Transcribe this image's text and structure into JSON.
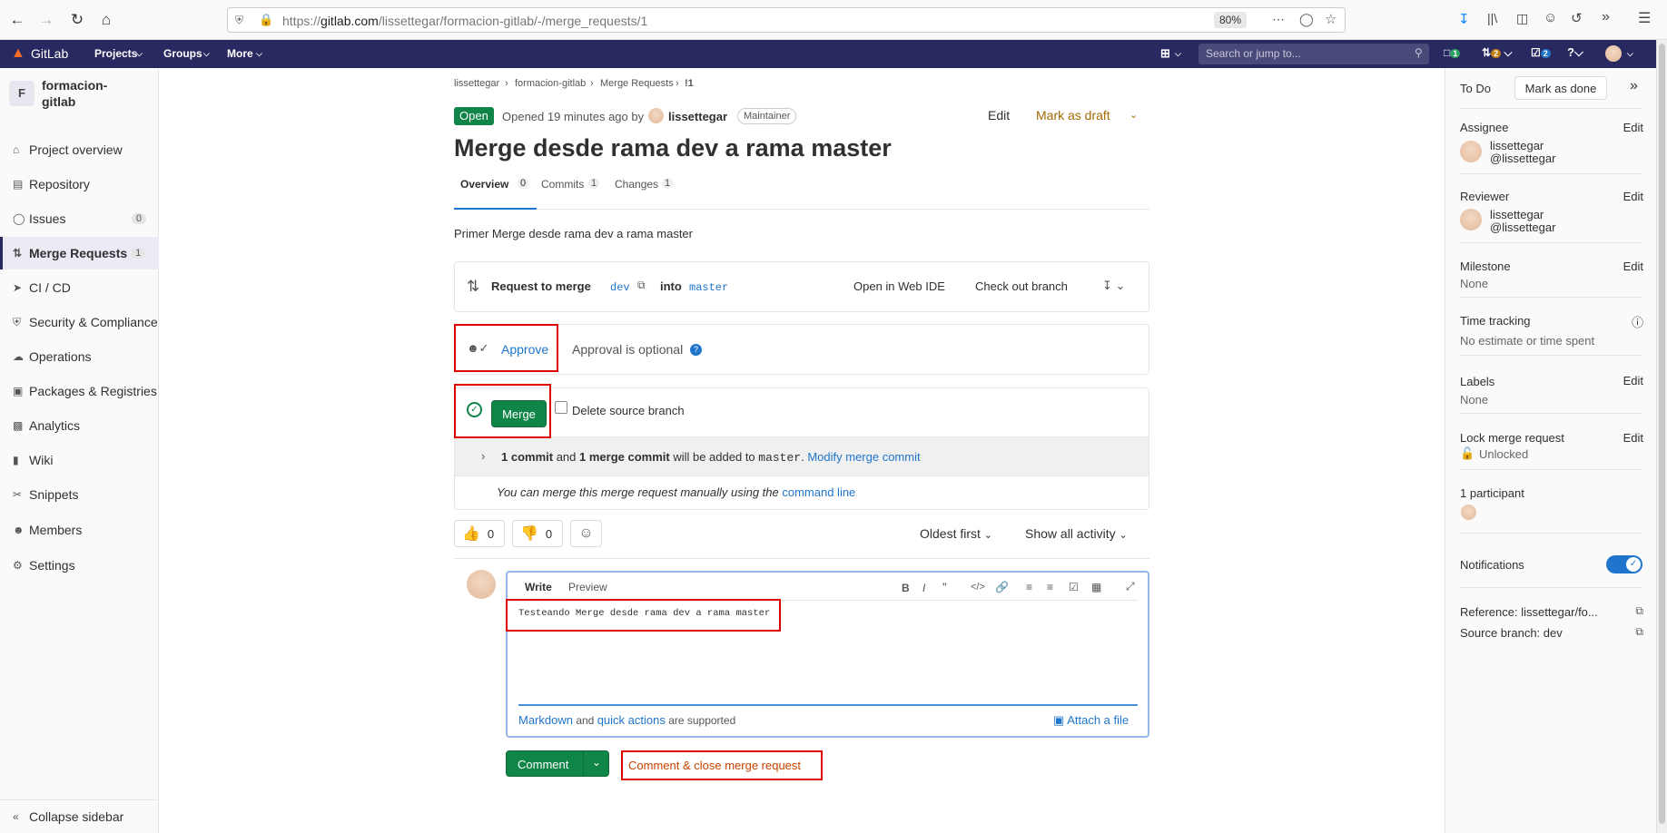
{
  "browser": {
    "url_prefix": "https://",
    "url_domain": "gitlab.com",
    "url_path": "/lissettegar/formacion-gitlab/-/merge_requests/1",
    "zoom": "80%"
  },
  "topbar": {
    "brand": "GitLab",
    "menus": [
      "Projects",
      "Groups",
      "More"
    ],
    "search_placeholder": "Search or jump to...",
    "counters": {
      "issues": "1",
      "merge_requests": "2",
      "todos": "2"
    }
  },
  "sidebar": {
    "project_initial": "F",
    "project_name_line1": "formacion-",
    "project_name_line2": "gitlab",
    "items": [
      {
        "label": "Project overview",
        "icon": "home-icon"
      },
      {
        "label": "Repository",
        "icon": "doc-icon"
      },
      {
        "label": "Issues",
        "icon": "issues-icon",
        "badge": "0"
      },
      {
        "label": "Merge Requests",
        "icon": "merge-request-icon",
        "badge": "1"
      },
      {
        "label": "CI / CD",
        "icon": "rocket-icon"
      },
      {
        "label": "Security & Compliance",
        "icon": "shield-icon"
      },
      {
        "label": "Operations",
        "icon": "cloud-icon"
      },
      {
        "label": "Packages & Registries",
        "icon": "package-icon"
      },
      {
        "label": "Analytics",
        "icon": "chart-icon"
      },
      {
        "label": "Wiki",
        "icon": "book-icon"
      },
      {
        "label": "Snippets",
        "icon": "scissors-icon"
      },
      {
        "label": "Members",
        "icon": "users-icon"
      },
      {
        "label": "Settings",
        "icon": "gear-icon"
      }
    ],
    "collapse": "Collapse sidebar"
  },
  "breadcrumb": [
    "lissettegar",
    "formacion-gitlab",
    "Merge Requests",
    "!1"
  ],
  "mr": {
    "status": "Open",
    "opened_text": "Opened 19 minutes ago by",
    "author": "lissettegar",
    "role": "Maintainer",
    "edit": "Edit",
    "mark_draft": "Mark as draft",
    "title": "Merge desde rama dev a rama master",
    "tabs": [
      {
        "label": "Overview",
        "count": "0"
      },
      {
        "label": "Commits",
        "count": "1"
      },
      {
        "label": "Changes",
        "count": "1"
      }
    ],
    "description": "Primer Merge desde rama dev a rama master",
    "request_to_merge": "Request to merge",
    "source_branch": "dev",
    "into": "into",
    "target_branch": "master",
    "open_web_ide": "Open in Web IDE",
    "checkout_branch": "Check out branch",
    "approve": "Approve",
    "approval_optional": "Approval is optional",
    "merge": "Merge",
    "delete_source": "Delete source branch",
    "commit_info_a": "1 commit",
    "commit_info_b": " and ",
    "commit_info_c": "1 merge commit",
    "commit_info_d": " will be added to ",
    "commit_info_e": "master",
    "commit_info_f": ".",
    "modify_commit": "Modify merge commit",
    "manual_text": "You can merge this merge request manually using the",
    "command_line": "command line",
    "thumbs_up": "0",
    "thumbs_down": "0",
    "sort": "Oldest first",
    "activity": "Show all activity"
  },
  "comment": {
    "tab_write": "Write",
    "tab_preview": "Preview",
    "text": "Testeando Merge desde rama dev a rama master",
    "markdown": "Markdown",
    "and": "and",
    "quick_actions": "quick actions",
    "supported": "are supported",
    "attach": "Attach a file",
    "submit": "Comment",
    "close": "Comment & close merge request"
  },
  "right_sidebar": {
    "todo": "To Do",
    "mark_done": "Mark as done",
    "assignee_label": "Assignee",
    "assignee_name": "lissettegar",
    "assignee_handle": "@lissettegar",
    "reviewer_label": "Reviewer",
    "reviewer_name": "lissettegar",
    "reviewer_handle": "@lissettegar",
    "milestone_label": "Milestone",
    "milestone_value": "None",
    "time_label": "Time tracking",
    "time_value": "No estimate or time spent",
    "labels_label": "Labels",
    "labels_value": "None",
    "lock_label": "Lock merge request",
    "lock_value": "Unlocked",
    "participants": "1 participant",
    "notifications": "Notifications",
    "reference": "Reference: lissettegar/fo...",
    "source_branch": "Source branch: dev",
    "edit": "Edit"
  }
}
